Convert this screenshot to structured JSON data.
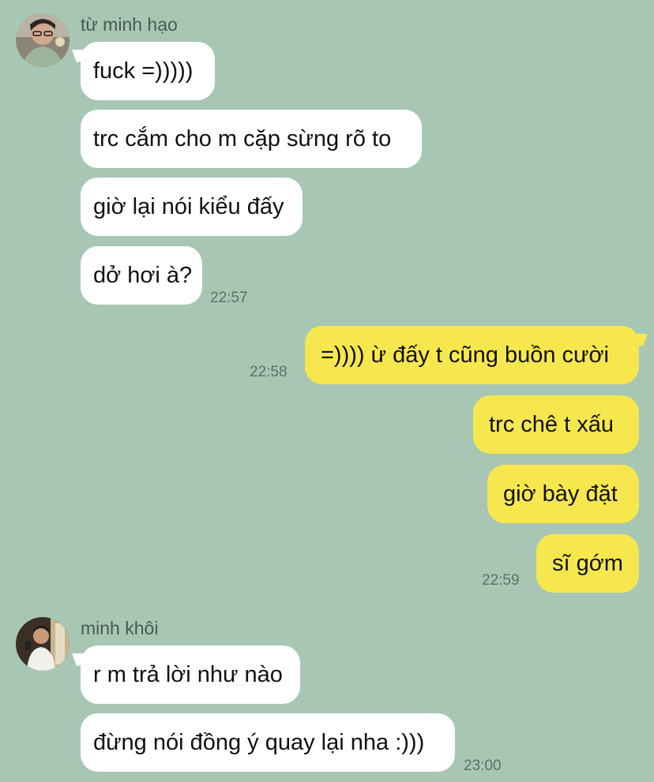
{
  "chat": {
    "colors": {
      "background": "#a8c6b4",
      "incoming_bubble": "#ffffff",
      "outgoing_bubble": "#f7e74f",
      "timestamp": "#5e7067"
    },
    "group1": {
      "sender": "từ minh hạo",
      "avatar_icon": "user-avatar-photo",
      "messages": [
        "fuck =)))))",
        "trc cắm cho m cặp sừng rõ to",
        "giờ lại nói kiểu đấy",
        "dở hơi à?"
      ],
      "time": "22:57"
    },
    "group2": {
      "messages": [
        "=)))) ừ đấy t cũng buồn cười",
        "trc chê t xấu",
        "giờ bày đặt",
        "sĩ gớm"
      ],
      "time_first": "22:58",
      "time_last": "22:59"
    },
    "group3": {
      "sender": "minh khôi",
      "avatar_icon": "user-avatar-photo",
      "messages": [
        "r m trả lời như nào",
        "đừng nói đồng ý quay lại nha :)))"
      ],
      "time": "23:00"
    }
  }
}
